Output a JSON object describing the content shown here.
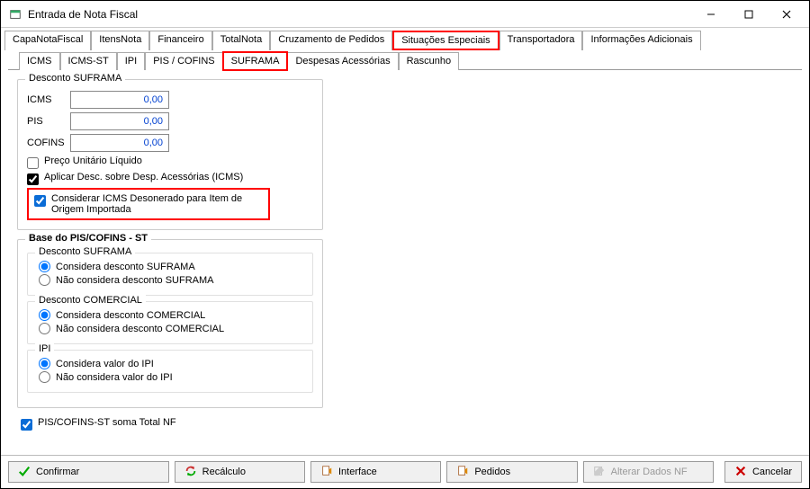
{
  "window": {
    "title": "Entrada de Nota Fiscal"
  },
  "tabs_main": {
    "items": [
      "CapaNotaFiscal",
      "ItensNota",
      "Financeiro",
      "TotalNota",
      "Cruzamento de Pedidos",
      "Situações Especiais",
      "Transportadora",
      "Informações Adicionais"
    ],
    "selected_index": 5
  },
  "tabs_sub": {
    "items": [
      "ICMS",
      "ICMS-ST",
      "IPI",
      "PIS / COFINS",
      "SUFRAMA",
      "Despesas Acessórias",
      "Rascunho"
    ],
    "selected_index": 4
  },
  "suframa": {
    "group_title": "Desconto SUFRAMA",
    "fields": {
      "icms": {
        "label": "ICMS",
        "value": "0,00"
      },
      "pis": {
        "label": "PIS",
        "value": "0,00"
      },
      "cofins": {
        "label": "COFINS",
        "value": "0,00"
      }
    },
    "checks": {
      "preco_unitario": {
        "label": "Preço Unitário Líquido",
        "checked": false
      },
      "aplicar_desc": {
        "label": "Aplicar Desc. sobre Desp.  Acessórias (ICMS)",
        "checked": true
      },
      "considerar_icms_desonerado": {
        "label": "Considerar ICMS Desonerado para Item de Origem Importada",
        "checked": true
      }
    }
  },
  "base": {
    "group_title": "Base do PIS/COFINS - ST",
    "desc_suframa": {
      "title": "Desconto SUFRAMA",
      "opt_considera": "Considera desconto SUFRAMA",
      "opt_nao": "Não considera desconto SUFRAMA",
      "selected": "considera"
    },
    "desc_comercial": {
      "title": "Desconto COMERCIAL",
      "opt_considera": "Considera desconto COMERCIAL",
      "opt_nao": "Não considera desconto COMERCIAL",
      "selected": "considera"
    },
    "ipi": {
      "title": "IPI",
      "opt_considera": "Considera valor do IPI",
      "opt_nao": "Não considera valor do IPI",
      "selected": "considera"
    }
  },
  "bottom_check": {
    "label": "PIS/COFINS-ST soma Total NF",
    "checked": true
  },
  "buttons": {
    "confirmar": "Confirmar",
    "recalculo": "Recálculo",
    "interface": "Interface",
    "pedidos": "Pedidos",
    "alterar": "Alterar Dados NF",
    "cancelar": "Cancelar"
  }
}
